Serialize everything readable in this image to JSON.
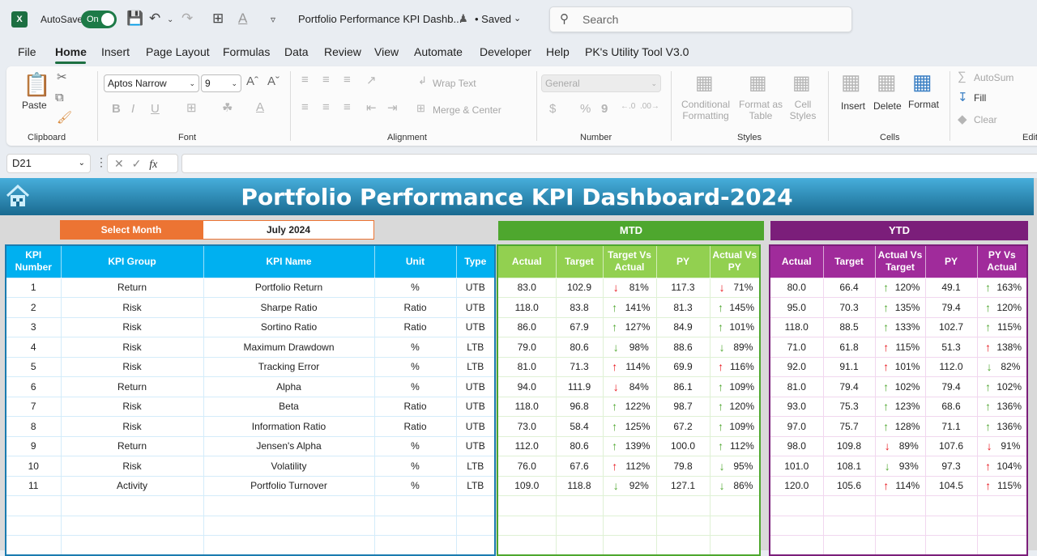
{
  "titlebar": {
    "app_icon": "excel-logo",
    "autosave_label": "AutoSave",
    "autosave_state": "On",
    "doc_title": "Portfolio Performance KPI Dashb...",
    "saved_status": "• Saved",
    "search_placeholder": "Search"
  },
  "menu": [
    "File",
    "Home",
    "Insert",
    "Page Layout",
    "Formulas",
    "Data",
    "Review",
    "View",
    "Automate",
    "Developer",
    "Help",
    "PK's Utility Tool V3.0"
  ],
  "ribbon": {
    "clipboard": {
      "paste": "Paste",
      "group": "Clipboard"
    },
    "font": {
      "family": "Aptos Narrow",
      "size": "9",
      "group": "Font",
      "bold": "B",
      "italic": "I",
      "underline": "U"
    },
    "alignment": {
      "wrap_text": "Wrap Text",
      "merge_center": "Merge & Center",
      "group": "Alignment"
    },
    "number": {
      "format": "General",
      "group": "Number",
      "currency": "$",
      "percent": "%",
      "comma": "9"
    },
    "styles": {
      "conditional_1": "Conditional",
      "conditional_2": "Formatting",
      "format_table_1": "Format as",
      "format_table_2": "Table",
      "cell_styles_1": "Cell",
      "cell_styles_2": "Styles",
      "group": "Styles"
    },
    "cells": {
      "insert": "Insert",
      "delete": "Delete",
      "format": "Format",
      "group": "Cells"
    },
    "editing": {
      "autosum": "AutoSum",
      "fill": "Fill",
      "clear": "Clear",
      "group": "Edit"
    }
  },
  "formula_bar": {
    "cell_ref": "D21",
    "fx": "fx",
    "value": ""
  },
  "dashboard": {
    "title": "Portfolio Performance KPI Dashboard-2024",
    "select_month_label": "Select Month",
    "selected_month": "July 2024",
    "mtd_label": "MTD",
    "ytd_label": "YTD",
    "kpi_headers": [
      "KPI Number",
      "KPI Group",
      "KPI Name",
      "Unit",
      "Type"
    ],
    "mtd_headers": [
      "Actual",
      "Target",
      "Target Vs Actual",
      "PY",
      "Actual Vs PY"
    ],
    "ytd_headers": [
      "Actual",
      "Target",
      "Actual Vs Target",
      "PY",
      "PY Vs Actual"
    ],
    "colors": {
      "banner_top": "#46aedb",
      "banner_bottom": "#1a6a90",
      "select_month": "#ec7433",
      "mtd": "#4ea72e",
      "mtd_header": "#92d050",
      "ytd": "#7b1e7a",
      "ytd_header": "#a02b9b",
      "kpi_header": "#00b0f0",
      "good": "#4ea72e",
      "bad": "#e8141b"
    },
    "rows": [
      {
        "num": "1",
        "group": "Return",
        "name": "Portfolio Return",
        "unit": "%",
        "type": "UTB",
        "mtd": {
          "actual": "83.0",
          "target": "102.9",
          "tva": {
            "pct": "81%",
            "dir": "down",
            "status": "bad"
          },
          "py": "117.3",
          "avp": {
            "pct": "71%",
            "dir": "down",
            "status": "bad"
          }
        },
        "ytd": {
          "actual": "80.0",
          "target": "66.4",
          "avt": {
            "pct": "120%",
            "dir": "up",
            "status": "good"
          },
          "py": "49.1",
          "pva": {
            "pct": "163%",
            "dir": "up",
            "status": "good"
          }
        }
      },
      {
        "num": "2",
        "group": "Risk",
        "name": "Sharpe Ratio",
        "unit": "Ratio",
        "type": "UTB",
        "mtd": {
          "actual": "118.0",
          "target": "83.8",
          "tva": {
            "pct": "141%",
            "dir": "up",
            "status": "good"
          },
          "py": "81.3",
          "avp": {
            "pct": "145%",
            "dir": "up",
            "status": "good"
          }
        },
        "ytd": {
          "actual": "95.0",
          "target": "70.3",
          "avt": {
            "pct": "135%",
            "dir": "up",
            "status": "good"
          },
          "py": "79.4",
          "pva": {
            "pct": "120%",
            "dir": "up",
            "status": "good"
          }
        }
      },
      {
        "num": "3",
        "group": "Risk",
        "name": "Sortino Ratio",
        "unit": "Ratio",
        "type": "UTB",
        "mtd": {
          "actual": "86.0",
          "target": "67.9",
          "tva": {
            "pct": "127%",
            "dir": "up",
            "status": "good"
          },
          "py": "84.9",
          "avp": {
            "pct": "101%",
            "dir": "up",
            "status": "good"
          }
        },
        "ytd": {
          "actual": "118.0",
          "target": "88.5",
          "avt": {
            "pct": "133%",
            "dir": "up",
            "status": "good"
          },
          "py": "102.7",
          "pva": {
            "pct": "115%",
            "dir": "up",
            "status": "good"
          }
        }
      },
      {
        "num": "4",
        "group": "Risk",
        "name": "Maximum Drawdown",
        "unit": "%",
        "type": "LTB",
        "mtd": {
          "actual": "79.0",
          "target": "80.6",
          "tva": {
            "pct": "98%",
            "dir": "down",
            "status": "good"
          },
          "py": "88.6",
          "avp": {
            "pct": "89%",
            "dir": "down",
            "status": "good"
          }
        },
        "ytd": {
          "actual": "71.0",
          "target": "61.8",
          "avt": {
            "pct": "115%",
            "dir": "up",
            "status": "bad"
          },
          "py": "51.3",
          "pva": {
            "pct": "138%",
            "dir": "up",
            "status": "bad"
          }
        }
      },
      {
        "num": "5",
        "group": "Risk",
        "name": "Tracking Error",
        "unit": "%",
        "type": "LTB",
        "mtd": {
          "actual": "81.0",
          "target": "71.3",
          "tva": {
            "pct": "114%",
            "dir": "up",
            "status": "bad"
          },
          "py": "69.9",
          "avp": {
            "pct": "116%",
            "dir": "up",
            "status": "bad"
          }
        },
        "ytd": {
          "actual": "92.0",
          "target": "91.1",
          "avt": {
            "pct": "101%",
            "dir": "up",
            "status": "bad"
          },
          "py": "112.0",
          "pva": {
            "pct": "82%",
            "dir": "down",
            "status": "good"
          }
        }
      },
      {
        "num": "6",
        "group": "Return",
        "name": "Alpha",
        "unit": "%",
        "type": "UTB",
        "mtd": {
          "actual": "94.0",
          "target": "111.9",
          "tva": {
            "pct": "84%",
            "dir": "down",
            "status": "bad"
          },
          "py": "86.1",
          "avp": {
            "pct": "109%",
            "dir": "up",
            "status": "good"
          }
        },
        "ytd": {
          "actual": "81.0",
          "target": "79.4",
          "avt": {
            "pct": "102%",
            "dir": "up",
            "status": "good"
          },
          "py": "79.4",
          "pva": {
            "pct": "102%",
            "dir": "up",
            "status": "good"
          }
        }
      },
      {
        "num": "7",
        "group": "Risk",
        "name": "Beta",
        "unit": "Ratio",
        "type": "UTB",
        "mtd": {
          "actual": "118.0",
          "target": "96.8",
          "tva": {
            "pct": "122%",
            "dir": "up",
            "status": "good"
          },
          "py": "98.7",
          "avp": {
            "pct": "120%",
            "dir": "up",
            "status": "good"
          }
        },
        "ytd": {
          "actual": "93.0",
          "target": "75.3",
          "avt": {
            "pct": "123%",
            "dir": "up",
            "status": "good"
          },
          "py": "68.6",
          "pva": {
            "pct": "136%",
            "dir": "up",
            "status": "good"
          }
        }
      },
      {
        "num": "8",
        "group": "Risk",
        "name": "Information Ratio",
        "unit": "Ratio",
        "type": "UTB",
        "mtd": {
          "actual": "73.0",
          "target": "58.4",
          "tva": {
            "pct": "125%",
            "dir": "up",
            "status": "good"
          },
          "py": "67.2",
          "avp": {
            "pct": "109%",
            "dir": "up",
            "status": "good"
          }
        },
        "ytd": {
          "actual": "97.0",
          "target": "75.7",
          "avt": {
            "pct": "128%",
            "dir": "up",
            "status": "good"
          },
          "py": "71.1",
          "pva": {
            "pct": "136%",
            "dir": "up",
            "status": "good"
          }
        }
      },
      {
        "num": "9",
        "group": "Return",
        "name": "Jensen's Alpha",
        "unit": "%",
        "type": "UTB",
        "mtd": {
          "actual": "112.0",
          "target": "80.6",
          "tva": {
            "pct": "139%",
            "dir": "up",
            "status": "good"
          },
          "py": "100.0",
          "avp": {
            "pct": "112%",
            "dir": "up",
            "status": "good"
          }
        },
        "ytd": {
          "actual": "98.0",
          "target": "109.8",
          "avt": {
            "pct": "89%",
            "dir": "down",
            "status": "bad"
          },
          "py": "107.6",
          "pva": {
            "pct": "91%",
            "dir": "down",
            "status": "bad"
          }
        }
      },
      {
        "num": "10",
        "group": "Risk",
        "name": "Volatility",
        "unit": "%",
        "type": "LTB",
        "mtd": {
          "actual": "76.0",
          "target": "67.6",
          "tva": {
            "pct": "112%",
            "dir": "up",
            "status": "bad"
          },
          "py": "79.8",
          "avp": {
            "pct": "95%",
            "dir": "down",
            "status": "good"
          }
        },
        "ytd": {
          "actual": "101.0",
          "target": "108.1",
          "avt": {
            "pct": "93%",
            "dir": "down",
            "status": "good"
          },
          "py": "97.3",
          "pva": {
            "pct": "104%",
            "dir": "up",
            "status": "bad"
          }
        }
      },
      {
        "num": "11",
        "group": "Activity",
        "name": "Portfolio Turnover",
        "unit": "%",
        "type": "LTB",
        "mtd": {
          "actual": "109.0",
          "target": "118.8",
          "tva": {
            "pct": "92%",
            "dir": "down",
            "status": "good"
          },
          "py": "127.1",
          "avp": {
            "pct": "86%",
            "dir": "down",
            "status": "good"
          }
        },
        "ytd": {
          "actual": "120.0",
          "target": "105.6",
          "avt": {
            "pct": "114%",
            "dir": "up",
            "status": "bad"
          },
          "py": "104.5",
          "pva": {
            "pct": "115%",
            "dir": "up",
            "status": "bad"
          }
        }
      }
    ]
  }
}
